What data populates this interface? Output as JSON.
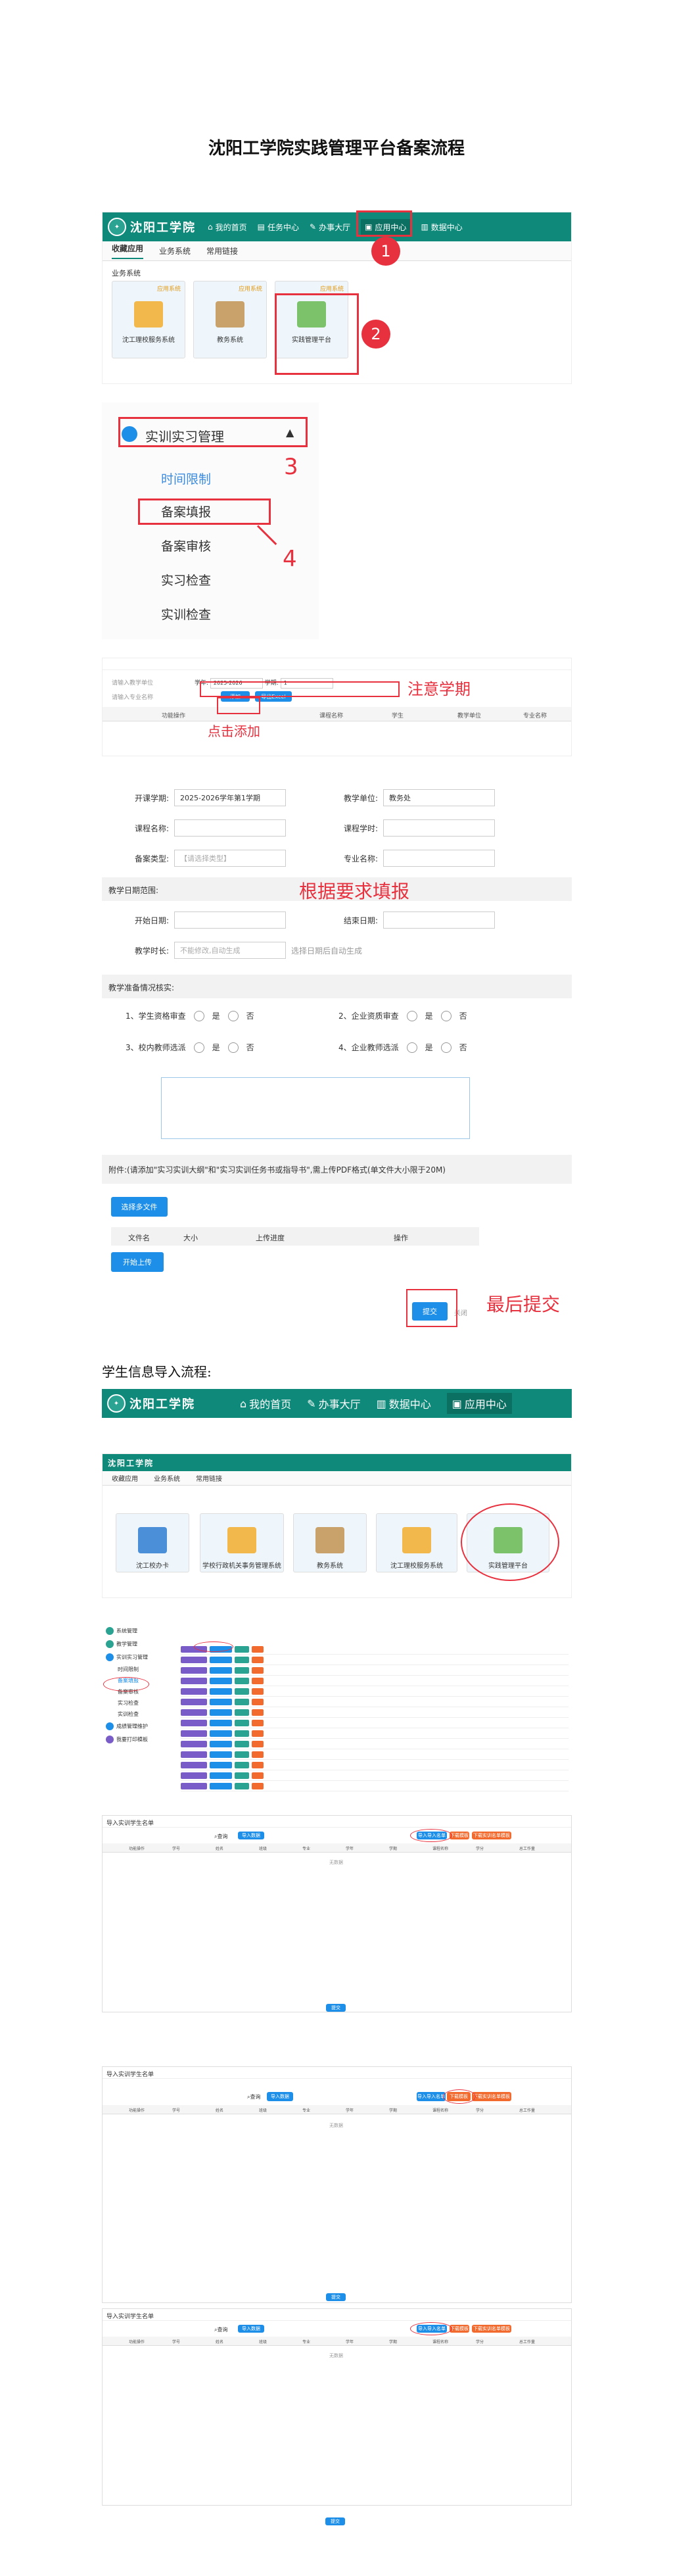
{
  "doc_title": "沈阳工学院实践管理平台备案流程",
  "app": {
    "school_name": "沈阳工学院",
    "nav": [
      "我的首页",
      "任务中心",
      "办事大厅",
      "应用中心",
      "数据中心"
    ],
    "nav2": [
      "我的首页",
      "办事大厅",
      "数据中心",
      "应用中心"
    ]
  },
  "tabs": [
    "收藏应用",
    "业务系统",
    "常用链接"
  ],
  "section_label": "业务系统",
  "cards": [
    {
      "label": "沈工理校服务系统",
      "tag": "应用系统"
    },
    {
      "label": "教务系统",
      "tag": "应用系统"
    },
    {
      "label": "实践管理平台",
      "tag": "应用系统"
    }
  ],
  "cards2": [
    {
      "label": "沈工校办卡"
    },
    {
      "label": "学校行政机关事务管理系统"
    },
    {
      "label": "教务系统"
    },
    {
      "label": "沈工理校服务系统"
    },
    {
      "label": "实践管理平台"
    }
  ],
  "annotations": {
    "step1": "1",
    "step2": "2",
    "step3": "3",
    "step4": "4",
    "note_semester": "注意学期",
    "note_add": "点击添加",
    "note_fill": "根据要求填报",
    "note_submit": "最后提交"
  },
  "menu": {
    "title": "实训实习管理",
    "items": [
      "时间限制",
      "备案填报",
      "备案审核",
      "实习检查",
      "实训检查"
    ]
  },
  "filter": {
    "semester_label": "学年:",
    "semester_value": "2025-2026",
    "term_label": "学期:",
    "term_value": "1",
    "add_btn": "添加",
    "export_btn": "导出Excel",
    "cols": [
      "功能操作",
      "课程名称",
      "学生",
      "教学单位",
      "专业名称"
    ]
  },
  "form": {
    "semester_label": "开课学期:",
    "semester_value": "2025-2026学年第1学期",
    "dept_label": "教学单位:",
    "dept_value": "教务处",
    "course_label": "课程名称:",
    "code_label": "课程学时:",
    "type_label": "备案类型:",
    "type_ph": "【请选择类型】",
    "major_label": "专业名称:",
    "period_title": "教学日期范围:",
    "start_label": "开始日期:",
    "end_label": "结束日期:",
    "hours_label": "教学时长:",
    "hours_ph": "不能修改,自动生成",
    "hours_note": "选择日期后自动生成",
    "check_title": "教学准备情况核实:",
    "checks": [
      "1、学生资格审查",
      "2、企业资质审查",
      "3、校内教师选派",
      "4、企业教师选派"
    ],
    "yes": "是",
    "no": "否",
    "attach_note": "附件:(请添加\"实习实训大纲\"和\"实习实训任务书或指导书\",需上传PDF格式(单文件大小限于20M)",
    "choose_files": "选择多文件",
    "file_cols": [
      "文件名",
      "大小",
      "上传进度",
      "操作"
    ],
    "upload_btn": "开始上传",
    "submit_btn": "提交",
    "close_btn": "关闭"
  },
  "import_title": "学生信息导入流程:",
  "import_modal": {
    "title": "导入实训学生名单",
    "search_btn": "查询",
    "import_btn": "导入数据",
    "download_btn": "下载模板",
    "buttons": [
      "导入导入名单",
      "下载模板",
      "下载实训名单模板"
    ],
    "empty": "无数据",
    "ok_btn": "确定",
    "cols": [
      "功能操作",
      "学号",
      "姓名",
      "班级",
      "专业",
      "学年",
      "学期",
      "课程名称",
      "学分",
      "总工作量"
    ]
  },
  "sidebar2": [
    "系统管理",
    "教学管理",
    "实训实习管理",
    "时间限制",
    "备案填报",
    "备案审核",
    "实习检查",
    "实训检查",
    "成绩管理维护",
    "我要打印模板"
  ]
}
